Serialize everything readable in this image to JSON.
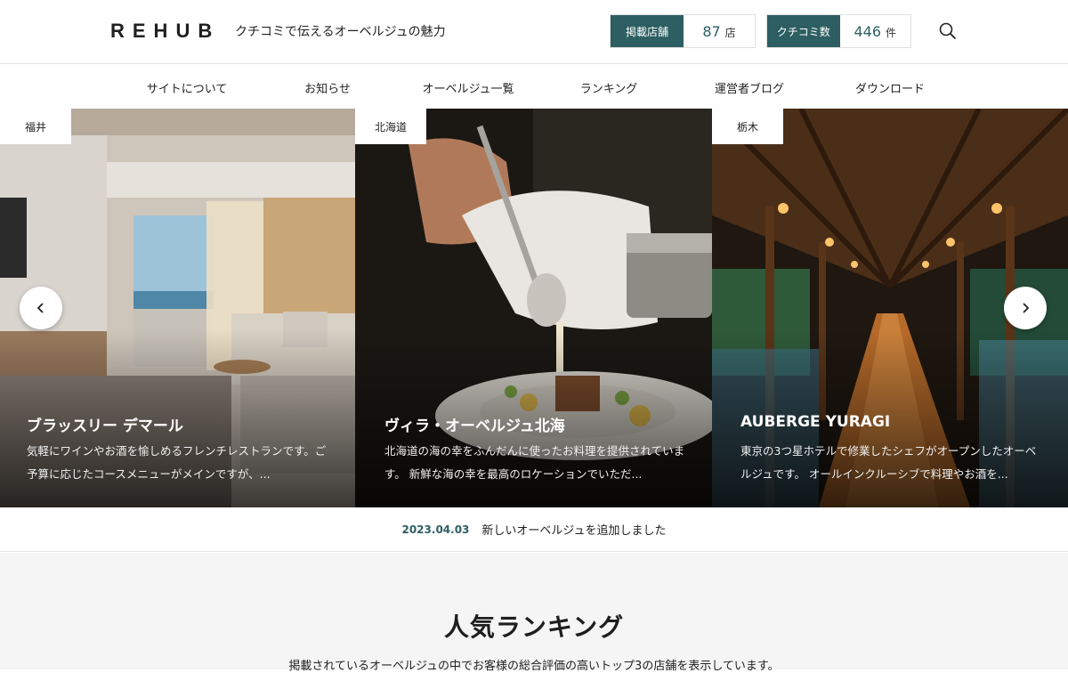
{
  "header": {
    "logo": "REHUB",
    "tagline": "クチコミで伝えるオーベルジュの魅力",
    "stats": [
      {
        "label": "掲載店舗",
        "value": "87",
        "unit": "店"
      },
      {
        "label": "クチコミ数",
        "value": "446",
        "unit": "件"
      }
    ],
    "search_icon": "search-icon"
  },
  "nav": {
    "items": [
      {
        "label": "サイトについて"
      },
      {
        "label": "お知らせ"
      },
      {
        "label": "オーベルジュ一覧"
      },
      {
        "label": "ランキング"
      },
      {
        "label": "運営者ブログ"
      },
      {
        "label": "ダウンロード"
      }
    ]
  },
  "slider": {
    "slides": [
      {
        "prefecture": "福井",
        "title": "ブラッスリー デマール",
        "description": "気軽にワインやお酒を愉しめるフレンチレストランです。ご予算に応じたコースメニューがメインですが、..."
      },
      {
        "prefecture": "北海道",
        "title": "ヴィラ・オーベルジュ北海",
        "description": "北海道の海の幸をふんだんに使ったお料理を提供されています。 新鮮な海の幸を最高のロケーションでいただ..."
      },
      {
        "prefecture": "栃木",
        "title": "AUBERGE YURAGI",
        "description": "東京の3つ星ホテルで修業したシェフがオープンしたオーベルジュです。 オールインクルーシブで料理やお酒を..."
      }
    ],
    "prev_icon": "chevron-left-icon",
    "next_icon": "chevron-right-icon"
  },
  "news": {
    "date": "2023.04.03",
    "text": "新しいオーベルジュを追加しました"
  },
  "ranking": {
    "title": "人気ランキング",
    "subtitle": "掲載されているオーベルジュの中でお客様の総合評価の高いトップ3の店舗を表示しています。"
  },
  "colors": {
    "accent": "#2d5f62",
    "section_bg": "#f5f5f5"
  }
}
